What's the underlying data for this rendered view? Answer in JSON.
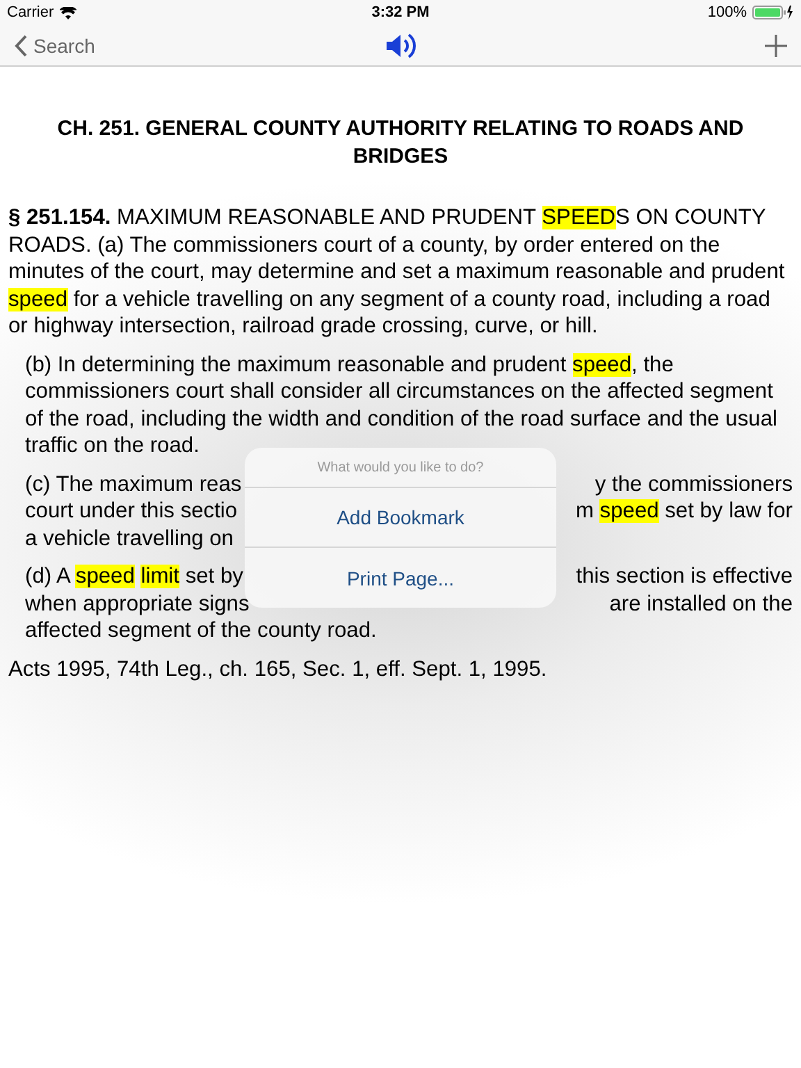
{
  "status_bar": {
    "carrier": "Carrier",
    "time": "3:32 PM",
    "battery": "100%"
  },
  "nav_bar": {
    "back": "Search"
  },
  "chapter_title": "CH. 251. GENERAL COUNTY AUTHORITY RELATING TO ROADS AND BRIDGES",
  "paragraphs": [
    {
      "kind": "full",
      "indented": false,
      "segments": [
        {
          "kind": "bold",
          "text": "§ 251.154."
        },
        {
          "kind": "plain",
          "text": " MAXIMUM REASONABLE AND PRUDENT "
        },
        {
          "kind": "highlight",
          "text": "SPEED"
        },
        {
          "kind": "plain",
          "text": "S ON COUNTY ROADS. (a) The commissioners court of a county, by order entered on the minutes of the court, may determine and set a maximum reasonable and prudent "
        },
        {
          "kind": "highlight",
          "text": "speed"
        },
        {
          "kind": "plain",
          "text": " for a vehicle travelling on any segment of a county road, including a road or highway intersection, railroad grade crossing, curve, or hill."
        }
      ]
    },
    {
      "kind": "full",
      "indented": true,
      "segments": [
        {
          "kind": "plain",
          "text": "(b) In determining the maximum reasonable and prudent "
        },
        {
          "kind": "highlight",
          "text": "speed"
        },
        {
          "kind": "plain",
          "text": ", the commissioners court shall consider all circumstances on the affected segment of the road, including the width and condition of the road surface and the usual traffic on the road."
        }
      ]
    },
    {
      "kind": "split",
      "indented": true,
      "lines": [
        {
          "left": [
            {
              "kind": "plain",
              "text": "(c) The maximum reas"
            }
          ],
          "right": [
            {
              "kind": "plain",
              "text": "y the commissioners"
            }
          ]
        },
        {
          "left": [
            {
              "kind": "plain",
              "text": "court under this sectio"
            }
          ],
          "right": [
            {
              "kind": "plain",
              "text": "m "
            },
            {
              "kind": "highlight",
              "text": "speed"
            },
            {
              "kind": "plain",
              "text": " set by law for"
            }
          ]
        },
        {
          "left": [
            {
              "kind": "plain",
              "text": "a vehicle travelling on"
            }
          ]
        }
      ]
    },
    {
      "kind": "split",
      "indented": true,
      "lines": [
        {
          "left": [
            {
              "kind": "plain",
              "text": "(d) A "
            },
            {
              "kind": "highlight",
              "text": "speed"
            },
            {
              "kind": "highlight",
              "text": "limit"
            },
            {
              "kind": "plain",
              "text": " set by"
            }
          ],
          "right": [
            {
              "kind": "plain",
              "text": "this section is effective"
            }
          ]
        },
        {
          "left": [
            {
              "kind": "plain",
              "text": "when appropriate signs"
            }
          ],
          "right": [
            {
              "kind": "plain",
              "text": "are installed on the"
            }
          ]
        },
        {
          "left": [
            {
              "kind": "plain",
              "text": "affected segment of the county road."
            }
          ]
        }
      ]
    }
  ],
  "footer": "Acts 1995, 74th Leg., ch. 165, Sec. 1, eff. Sept. 1, 1995.",
  "popover": {
    "title": "What would you like to do?",
    "actions": [
      "Add Bookmark",
      "Print Page..."
    ]
  }
}
